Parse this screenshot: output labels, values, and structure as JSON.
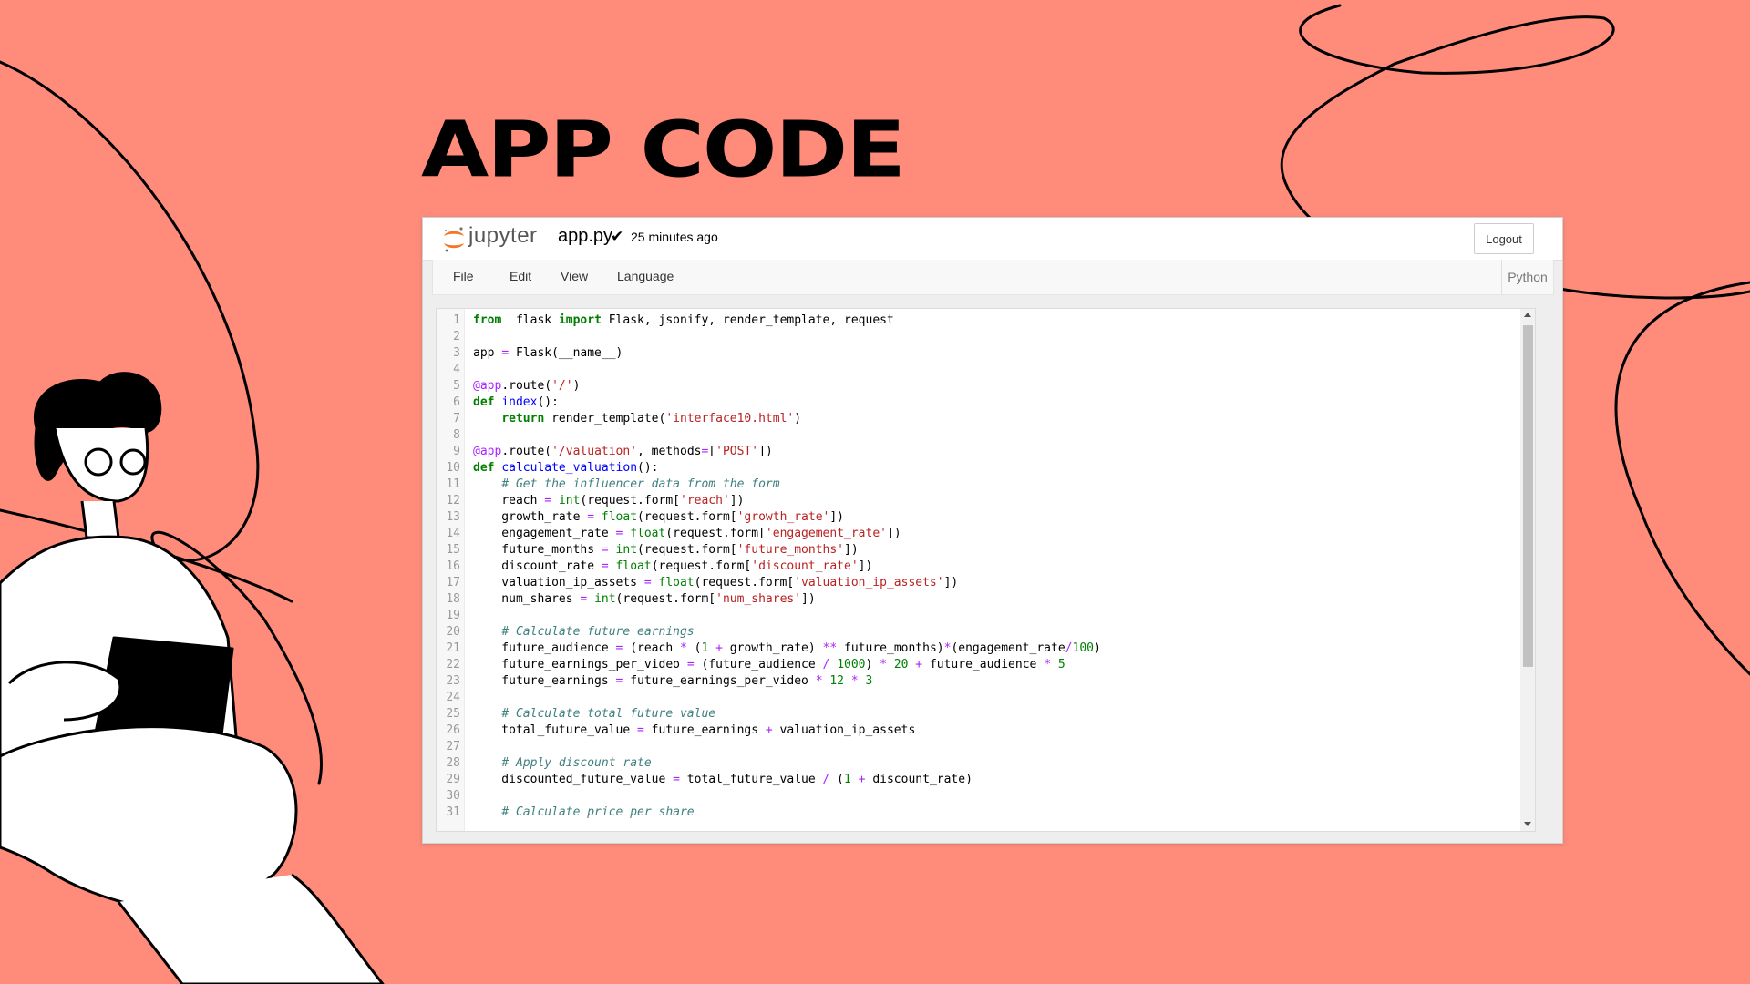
{
  "slide": {
    "title": "App Code"
  },
  "header": {
    "brand": "jupyter",
    "filename": "app.py",
    "save_status": "25 minutes ago",
    "logout_label": "Logout"
  },
  "menu": {
    "items": [
      "File",
      "Edit",
      "View",
      "Language"
    ],
    "kernel_label": "Python"
  },
  "code_lines": [
    [
      [
        "kw",
        "from"
      ],
      [
        "",
        "  flask "
      ],
      [
        "kw",
        "import"
      ],
      [
        "",
        " Flask, jsonify, render_template, request"
      ]
    ],
    [],
    [
      [
        "",
        "app "
      ],
      [
        "op",
        "="
      ],
      [
        "",
        " Flask(__name__)"
      ]
    ],
    [],
    [
      [
        "dec",
        "@app"
      ],
      [
        "",
        ".route("
      ],
      [
        "str",
        "'/'"
      ],
      [
        "",
        ")"
      ]
    ],
    [
      [
        "kw",
        "def"
      ],
      [
        "",
        " "
      ],
      [
        "def",
        "index"
      ],
      [
        "",
        "():"
      ]
    ],
    [
      [
        "",
        "    "
      ],
      [
        "kw",
        "return"
      ],
      [
        "",
        " render_template("
      ],
      [
        "str",
        "'interface10.html'"
      ],
      [
        "",
        ")"
      ]
    ],
    [],
    [
      [
        "dec",
        "@app"
      ],
      [
        "",
        ".route("
      ],
      [
        "str",
        "'/valuation'"
      ],
      [
        "",
        ", methods"
      ],
      [
        "op",
        "="
      ],
      [
        "",
        "["
      ],
      [
        "str",
        "'POST'"
      ],
      [
        "",
        "])"
      ]
    ],
    [
      [
        "kw",
        "def"
      ],
      [
        "",
        " "
      ],
      [
        "def",
        "calculate_valuation"
      ],
      [
        "",
        "():"
      ]
    ],
    [
      [
        "",
        "    "
      ],
      [
        "cmt",
        "# Get the influencer data from the form"
      ]
    ],
    [
      [
        "",
        "    reach "
      ],
      [
        "op",
        "="
      ],
      [
        "",
        " "
      ],
      [
        "bi",
        "int"
      ],
      [
        "",
        "(request.form["
      ],
      [
        "str",
        "'reach'"
      ],
      [
        "",
        "])"
      ]
    ],
    [
      [
        "",
        "    growth_rate "
      ],
      [
        "op",
        "="
      ],
      [
        "",
        " "
      ],
      [
        "bi",
        "float"
      ],
      [
        "",
        "(request.form["
      ],
      [
        "str",
        "'growth_rate'"
      ],
      [
        "",
        "])"
      ]
    ],
    [
      [
        "",
        "    engagement_rate "
      ],
      [
        "op",
        "="
      ],
      [
        "",
        " "
      ],
      [
        "bi",
        "float"
      ],
      [
        "",
        "(request.form["
      ],
      [
        "str",
        "'engagement_rate'"
      ],
      [
        "",
        "])"
      ]
    ],
    [
      [
        "",
        "    future_months "
      ],
      [
        "op",
        "="
      ],
      [
        "",
        " "
      ],
      [
        "bi",
        "int"
      ],
      [
        "",
        "(request.form["
      ],
      [
        "str",
        "'future_months'"
      ],
      [
        "",
        "])"
      ]
    ],
    [
      [
        "",
        "    discount_rate "
      ],
      [
        "op",
        "="
      ],
      [
        "",
        " "
      ],
      [
        "bi",
        "float"
      ],
      [
        "",
        "(request.form["
      ],
      [
        "str",
        "'discount_rate'"
      ],
      [
        "",
        "])"
      ]
    ],
    [
      [
        "",
        "    valuation_ip_assets "
      ],
      [
        "op",
        "="
      ],
      [
        "",
        " "
      ],
      [
        "bi",
        "float"
      ],
      [
        "",
        "(request.form["
      ],
      [
        "str",
        "'valuation_ip_assets'"
      ],
      [
        "",
        "])"
      ]
    ],
    [
      [
        "",
        "    num_shares "
      ],
      [
        "op",
        "="
      ],
      [
        "",
        " "
      ],
      [
        "bi",
        "int"
      ],
      [
        "",
        "(request.form["
      ],
      [
        "str",
        "'num_shares'"
      ],
      [
        "",
        "])"
      ]
    ],
    [],
    [
      [
        "",
        "    "
      ],
      [
        "cmt",
        "# Calculate future earnings"
      ]
    ],
    [
      [
        "",
        "    future_audience "
      ],
      [
        "op",
        "="
      ],
      [
        "",
        " (reach "
      ],
      [
        "op",
        "*"
      ],
      [
        "",
        " ("
      ],
      [
        "num",
        "1"
      ],
      [
        "",
        " "
      ],
      [
        "op",
        "+"
      ],
      [
        "",
        " growth_rate) "
      ],
      [
        "op",
        "**"
      ],
      [
        "",
        " future_months)"
      ],
      [
        "op",
        "*"
      ],
      [
        "",
        "(engagement_rate"
      ],
      [
        "op",
        "/"
      ],
      [
        "num",
        "100"
      ],
      [
        "",
        ")"
      ]
    ],
    [
      [
        "",
        "    future_earnings_per_video "
      ],
      [
        "op",
        "="
      ],
      [
        "",
        " (future_audience "
      ],
      [
        "op",
        "/"
      ],
      [
        "",
        " "
      ],
      [
        "num",
        "1000"
      ],
      [
        "",
        ") "
      ],
      [
        "op",
        "*"
      ],
      [
        "",
        " "
      ],
      [
        "num",
        "20"
      ],
      [
        "",
        " "
      ],
      [
        "op",
        "+"
      ],
      [
        "",
        " future_audience "
      ],
      [
        "op",
        "*"
      ],
      [
        "",
        " "
      ],
      [
        "num",
        "5"
      ]
    ],
    [
      [
        "",
        "    future_earnings "
      ],
      [
        "op",
        "="
      ],
      [
        "",
        " future_earnings_per_video "
      ],
      [
        "op",
        "*"
      ],
      [
        "",
        " "
      ],
      [
        "num",
        "12"
      ],
      [
        "",
        " "
      ],
      [
        "op",
        "*"
      ],
      [
        "",
        " "
      ],
      [
        "num",
        "3"
      ]
    ],
    [],
    [
      [
        "",
        "    "
      ],
      [
        "cmt",
        "# Calculate total future value"
      ]
    ],
    [
      [
        "",
        "    total_future_value "
      ],
      [
        "op",
        "="
      ],
      [
        "",
        " future_earnings "
      ],
      [
        "op",
        "+"
      ],
      [
        "",
        " valuation_ip_assets"
      ]
    ],
    [],
    [
      [
        "",
        "    "
      ],
      [
        "cmt",
        "# Apply discount rate"
      ]
    ],
    [
      [
        "",
        "    discounted_future_value "
      ],
      [
        "op",
        "="
      ],
      [
        "",
        " total_future_value "
      ],
      [
        "op",
        "/"
      ],
      [
        "",
        " ("
      ],
      [
        "num",
        "1"
      ],
      [
        "",
        " "
      ],
      [
        "op",
        "+"
      ],
      [
        "",
        " discount_rate)"
      ]
    ],
    [],
    [
      [
        "",
        "    "
      ],
      [
        "cmt",
        "# Calculate price per share"
      ]
    ]
  ]
}
